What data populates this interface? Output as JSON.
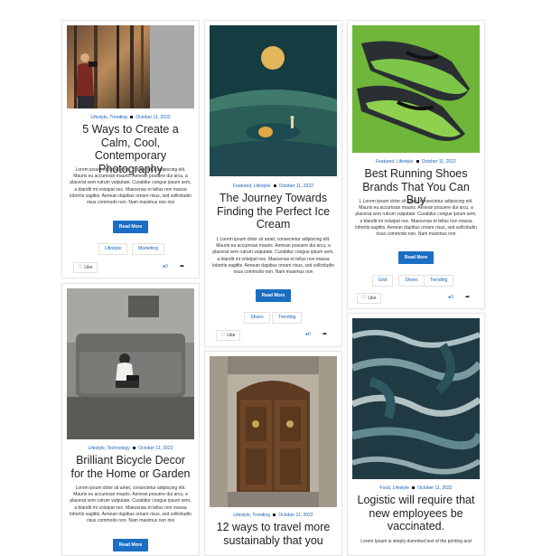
{
  "cards": [
    {
      "categories": [
        "Lifestyle",
        "Trending"
      ],
      "date": "October 11, 2022",
      "title": "5 Ways to Create a Calm, Cool, Contemporary Photography",
      "excerpt": "Lorem ipsum dolor sit amet, consectetur adipiscing elit. Mauris eu accumsan mauris. Aenean posuere dui arcu, a placerat sem rutrum vulputate. Curabitur congue ipsum sem, a blandit mi volutpat nec. Maecenas et tellus non massa lobortis sagittis. Aenean dapibus ornare risus, sed sollicitudin risus commodo non. Nam maximus non nisi",
      "button": "Read More",
      "tags": [
        "Lifestyle",
        "Marketing"
      ],
      "like": "Like",
      "comments": "0",
      "image_icon": "photographer-in-forest-image"
    },
    {
      "categories": [
        "Featured",
        "Lifestyle"
      ],
      "date": "October 11, 2022",
      "title": "The Journey Towards Finding the Perfect Ice Cream",
      "excerpt": "L Lorem ipsum dolor sit amet, consectetur adipiscing elit. Mauris eu accumsan mauris. Aenean posuere dui arcu, a placerat sem rutrum vulputate. Curabitur congue ipsum sem, a blandit mi volutpat nec. Maecenas et tellus non massa lobortis sagittis. Aenean dapibus ornare risus, sed sollicitudin risus commodo non. Nam maximus non",
      "button": "Read More",
      "tags": [
        "Shoes",
        "Trending"
      ],
      "like": "Like",
      "comments": "0",
      "image_icon": "moon-landscape-illustration"
    },
    {
      "categories": [
        "Featured",
        "Lifestyle"
      ],
      "date": "October 11, 2022",
      "title": "Best Running Shoes Brands That You Can Buy",
      "excerpt": "L Lorem ipsum dolor sit amet, consectetur adipiscing elit. Mauris eu accumsan mauris. Aenean posuere dui arcu, a placerat sem rutrum vulputate. Curabitur congue ipsum sem, a blandit mi volutpat nec. Maecenas et tellus non massa lobortis sagittis. Aenean dapibus ornare risus, sed sollicitudin risus commodo non. Nam maximus non",
      "button": "Read More",
      "tags": [
        "Grid",
        "Shoes",
        "Trending"
      ],
      "like": "Like",
      "comments": "0",
      "image_icon": "green-running-shoes-image"
    },
    {
      "categories": [
        "Lifestyle",
        "Technology"
      ],
      "date": "October 11, 2022",
      "title": "Brilliant Bicycle Decor for the Home or Garden",
      "excerpt": "Lorem ipsum dolor sit amet, consectetur adipiscing elit. Mauris eu accumsan mauris. Aenean posuere dui arcu, a placerat sem rutrum vulputate. Curabitur congue ipsum sem, a blandit mi volutpat nec. Maecenas et tellus non massa lobortis sagittis. Aenean dapibus ornare risus, sed sollicitudin risus commodo non. Nam maximus non nisi",
      "button": "Read More",
      "image_icon": "person-on-sofa-image"
    },
    {
      "categories": [
        "Lifestyle",
        "Trending"
      ],
      "date": "October 11, 2022",
      "title": "12 ways to travel more sustainably that you",
      "image_icon": "wooden-door-image"
    },
    {
      "categories": [
        "Food",
        "Lifestyle"
      ],
      "date": "October 11, 2022",
      "title": "Logistic will require that new employees be vaccinated.",
      "excerpt": "Lorem Ipsum is simply dummied text of the printing and",
      "image_icon": "ocean-waves-image"
    }
  ]
}
